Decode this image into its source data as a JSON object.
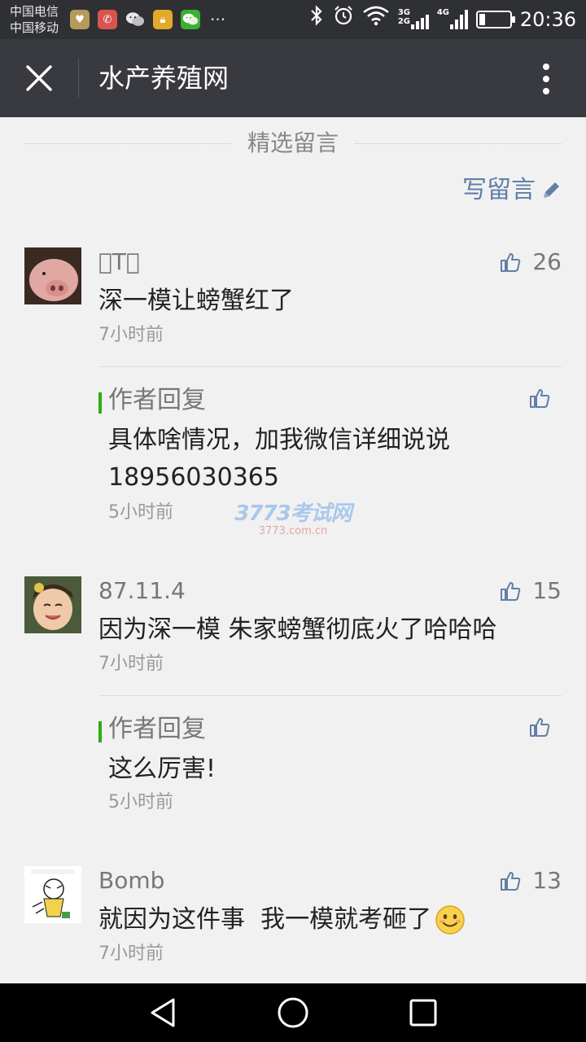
{
  "status_bar": {
    "carrier_line1": "中国电信",
    "carrier_line2": "中国移动",
    "more_indicator": "···",
    "net1_label_top": "3G",
    "net1_label_bottom": "2G",
    "net2_label": "4G",
    "battery_level": 0.2,
    "time": "20:36",
    "icons": [
      "app-notification-icon",
      "missed-call-icon",
      "wechat-icon",
      "lock-app-icon",
      "wechat-icon",
      "bluetooth-icon",
      "alarm-icon",
      "wifi-icon",
      "signal-icon",
      "battery-icon"
    ]
  },
  "header": {
    "title": "水产养殖网",
    "close_icon": "close-icon",
    "more_icon": "more-vertical-icon"
  },
  "section": {
    "title": "精选留言",
    "write_label": "写留言"
  },
  "comments": [
    {
      "nickname": "～T⃣",
      "likes": "26",
      "text": "深一模让螃蟹红了",
      "time": "7小时前",
      "reply": {
        "label": "作者回复",
        "text": "具体啥情况，加我微信详细说说 18956030365",
        "time": "5小时前"
      }
    },
    {
      "nickname": "87.11.4",
      "likes": "15",
      "text": "因为深一模 朱家螃蟹彻底火了哈哈哈",
      "time": "7小时前",
      "reply": {
        "label": "作者回复",
        "text": "这么厉害!",
        "time": "5小时前"
      }
    },
    {
      "nickname": "Bomb",
      "likes": "13",
      "text": "就因为这件事  我一模就考砸了",
      "time": "7小时前"
    }
  ],
  "watermark": {
    "main": "3773考试网",
    "sub": "3773.com.cn"
  },
  "navbar": {
    "icons": [
      "back-triangle-icon",
      "home-circle-icon",
      "recents-square-icon"
    ]
  },
  "colors": {
    "titlebar": "#393a3f",
    "statusbar": "#2f3033",
    "link_blue": "#607fa6",
    "reply_green": "#2bad13",
    "background": "#f1f1f1"
  }
}
